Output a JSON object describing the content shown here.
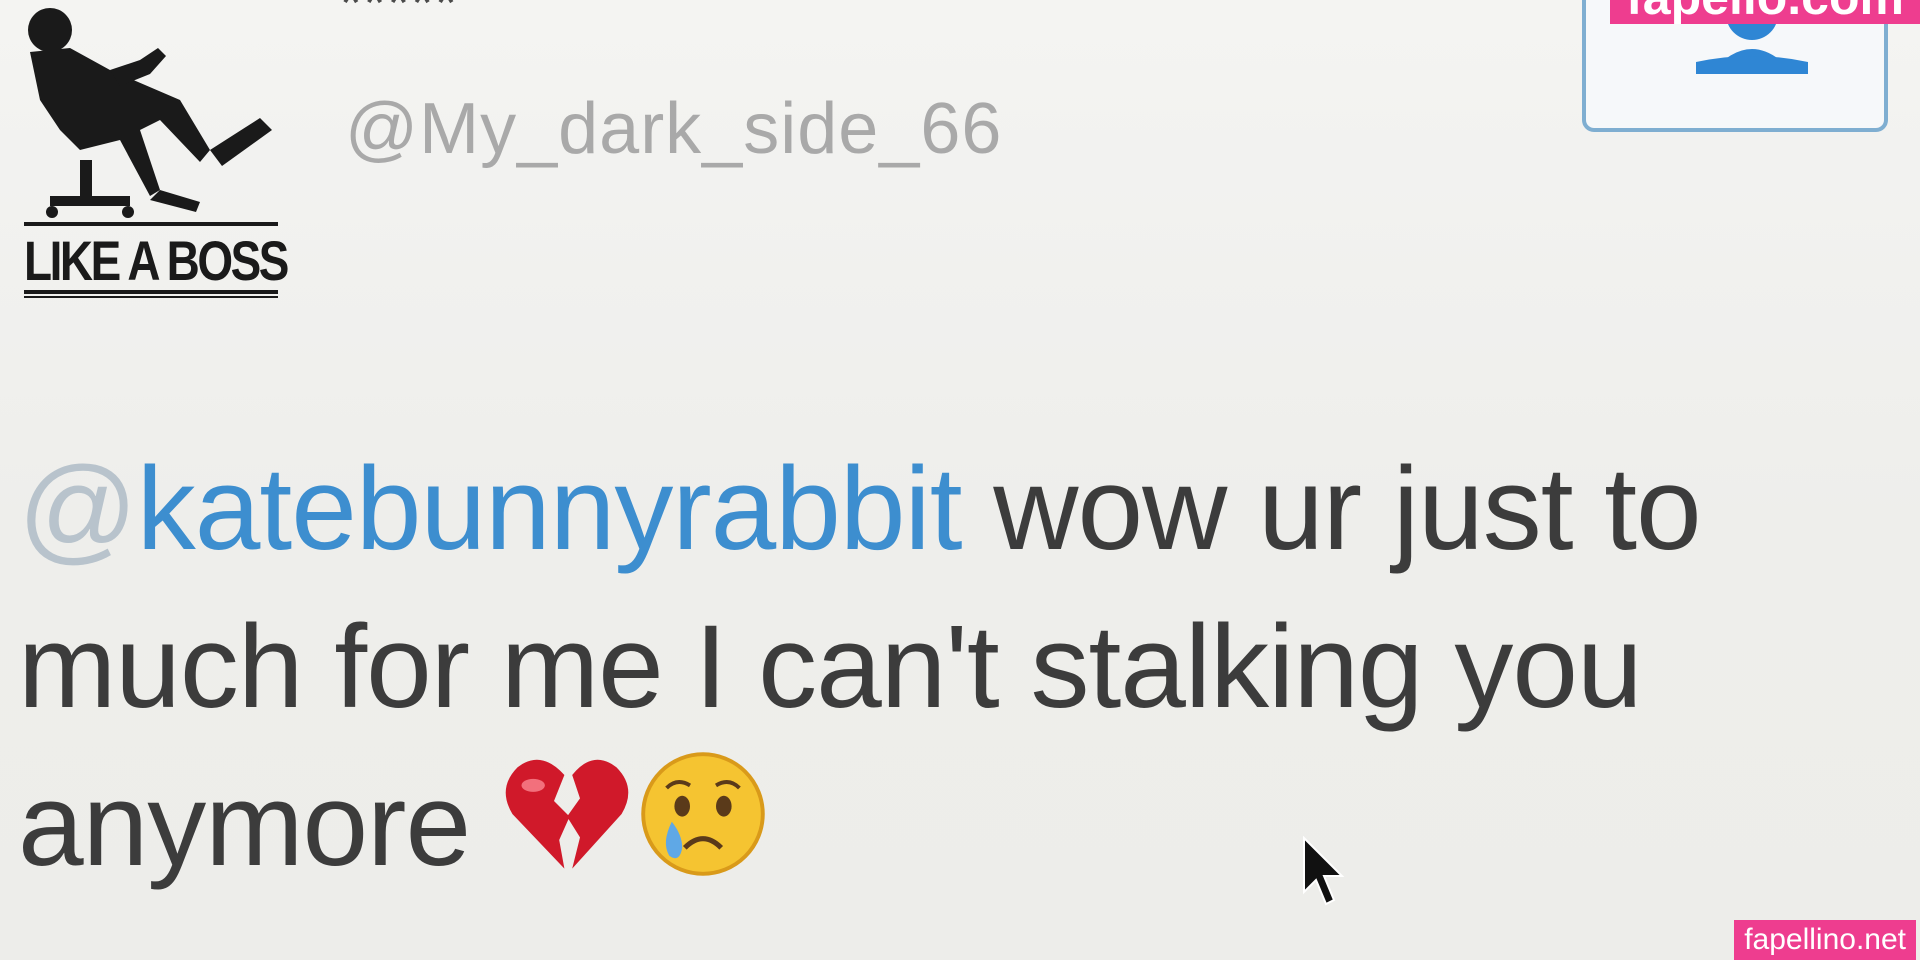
{
  "profile": {
    "avatar_caption": "LIKE A BOSS",
    "display_name": "*****",
    "handle": "@My_dark_side_66"
  },
  "follow_button": {
    "icon": "add-user-icon"
  },
  "tweet": {
    "mention_at": "@",
    "mention_name": "katebunnyrabbit",
    "text": " wow ur just to much for me I can't stalking you anymore ",
    "emojis": [
      "broken-heart-icon",
      "crying-face-icon"
    ]
  },
  "watermarks": {
    "top": "fapello.com",
    "bottom": "fapellino.net"
  },
  "colors": {
    "mention": "#3d8ecf",
    "follow_border": "#7faed1",
    "watermark": "#ee3d8f"
  }
}
